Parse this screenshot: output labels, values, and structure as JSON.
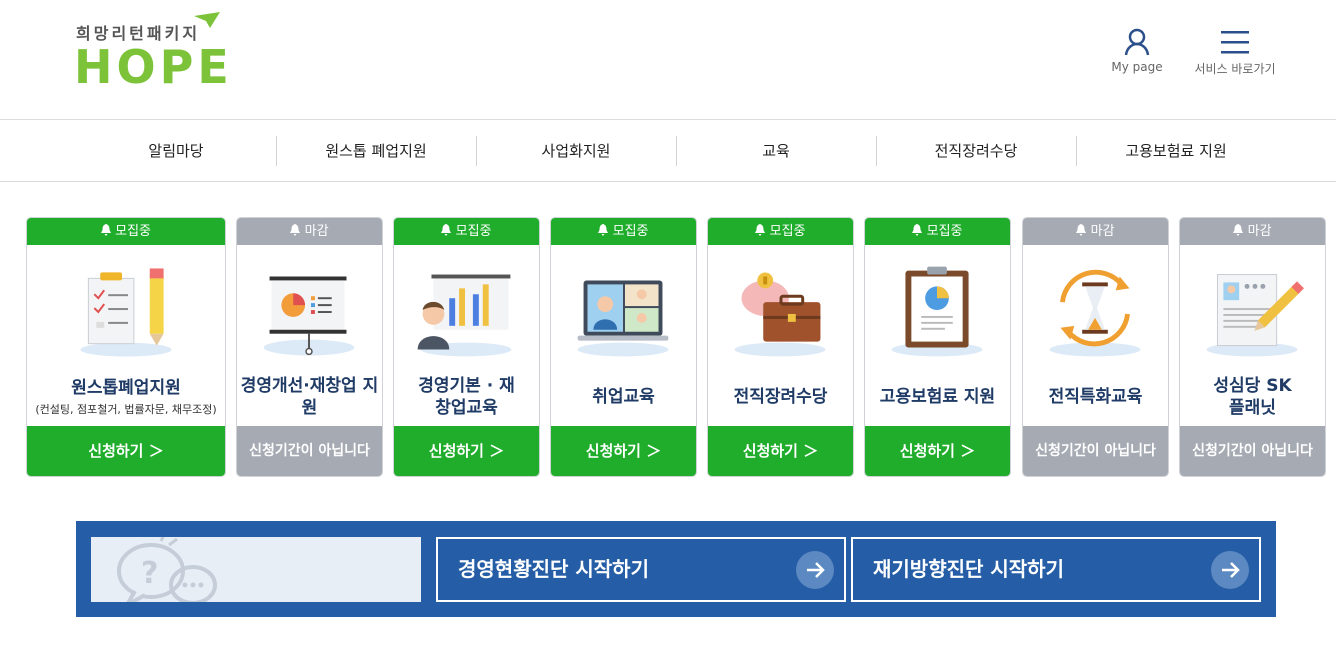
{
  "logo": {
    "subtitle": "희망리턴패키지",
    "title": "HOPE"
  },
  "header": {
    "mypage_label": "My page",
    "service_label": "서비스 바로가기"
  },
  "gnb": [
    {
      "label": "알림마당"
    },
    {
      "label": "원스톱 폐업지원"
    },
    {
      "label": "사업화지원"
    },
    {
      "label": "교육"
    },
    {
      "label": "전직장려수당"
    },
    {
      "label": "고용보험료 지원"
    }
  ],
  "cards": [
    {
      "status": "모집중",
      "title": "원스톱폐업지원",
      "subtitle": "(컨설팅, 점포철거, 법률자문, 채무조정)",
      "button": "신청하기 ＞",
      "state": "open",
      "icon": "clipboard-checklist-icon"
    },
    {
      "status": "마감",
      "title": "경영개선·재창업 지원",
      "subtitle": "",
      "button": "신청기간이 아닙니다",
      "state": "closed",
      "icon": "presentation-board-icon"
    },
    {
      "status": "모집중",
      "title": "경영기본 · 재창업교육",
      "subtitle": "",
      "button": "신청하기 ＞",
      "state": "open",
      "icon": "chart-presenter-icon"
    },
    {
      "status": "모집중",
      "title": "취업교육",
      "subtitle": "",
      "button": "신청하기 ＞",
      "state": "open",
      "icon": "video-meeting-icon"
    },
    {
      "status": "모집중",
      "title": "전직장려수당",
      "subtitle": "",
      "button": "신청하기 ＞",
      "state": "open",
      "icon": "piggybank-briefcase-icon"
    },
    {
      "status": "모집중",
      "title": "고용보험료 지원",
      "subtitle": "",
      "button": "신청하기 ＞",
      "state": "open",
      "icon": "clipboard-pie-icon"
    },
    {
      "status": "마감",
      "title": "전직특화교육",
      "subtitle": "",
      "button": "신청기간이 아닙니다",
      "state": "closed",
      "icon": "hourglass-icon"
    },
    {
      "status": "마감",
      "title": "성심당 SK플래닛",
      "subtitle": "",
      "button": "신청기간이 아닙니다",
      "state": "closed",
      "icon": "resume-pen-icon"
    }
  ],
  "diagnosis": {
    "business_label": "경영현황진단 시작하기",
    "restart_label": "재기방향진단 시작하기"
  },
  "colors": {
    "open": "#1fad2b",
    "closed": "#a5aab3",
    "title": "#1f3b66",
    "banner": "#255ea6",
    "logo": "#7cc33a"
  }
}
